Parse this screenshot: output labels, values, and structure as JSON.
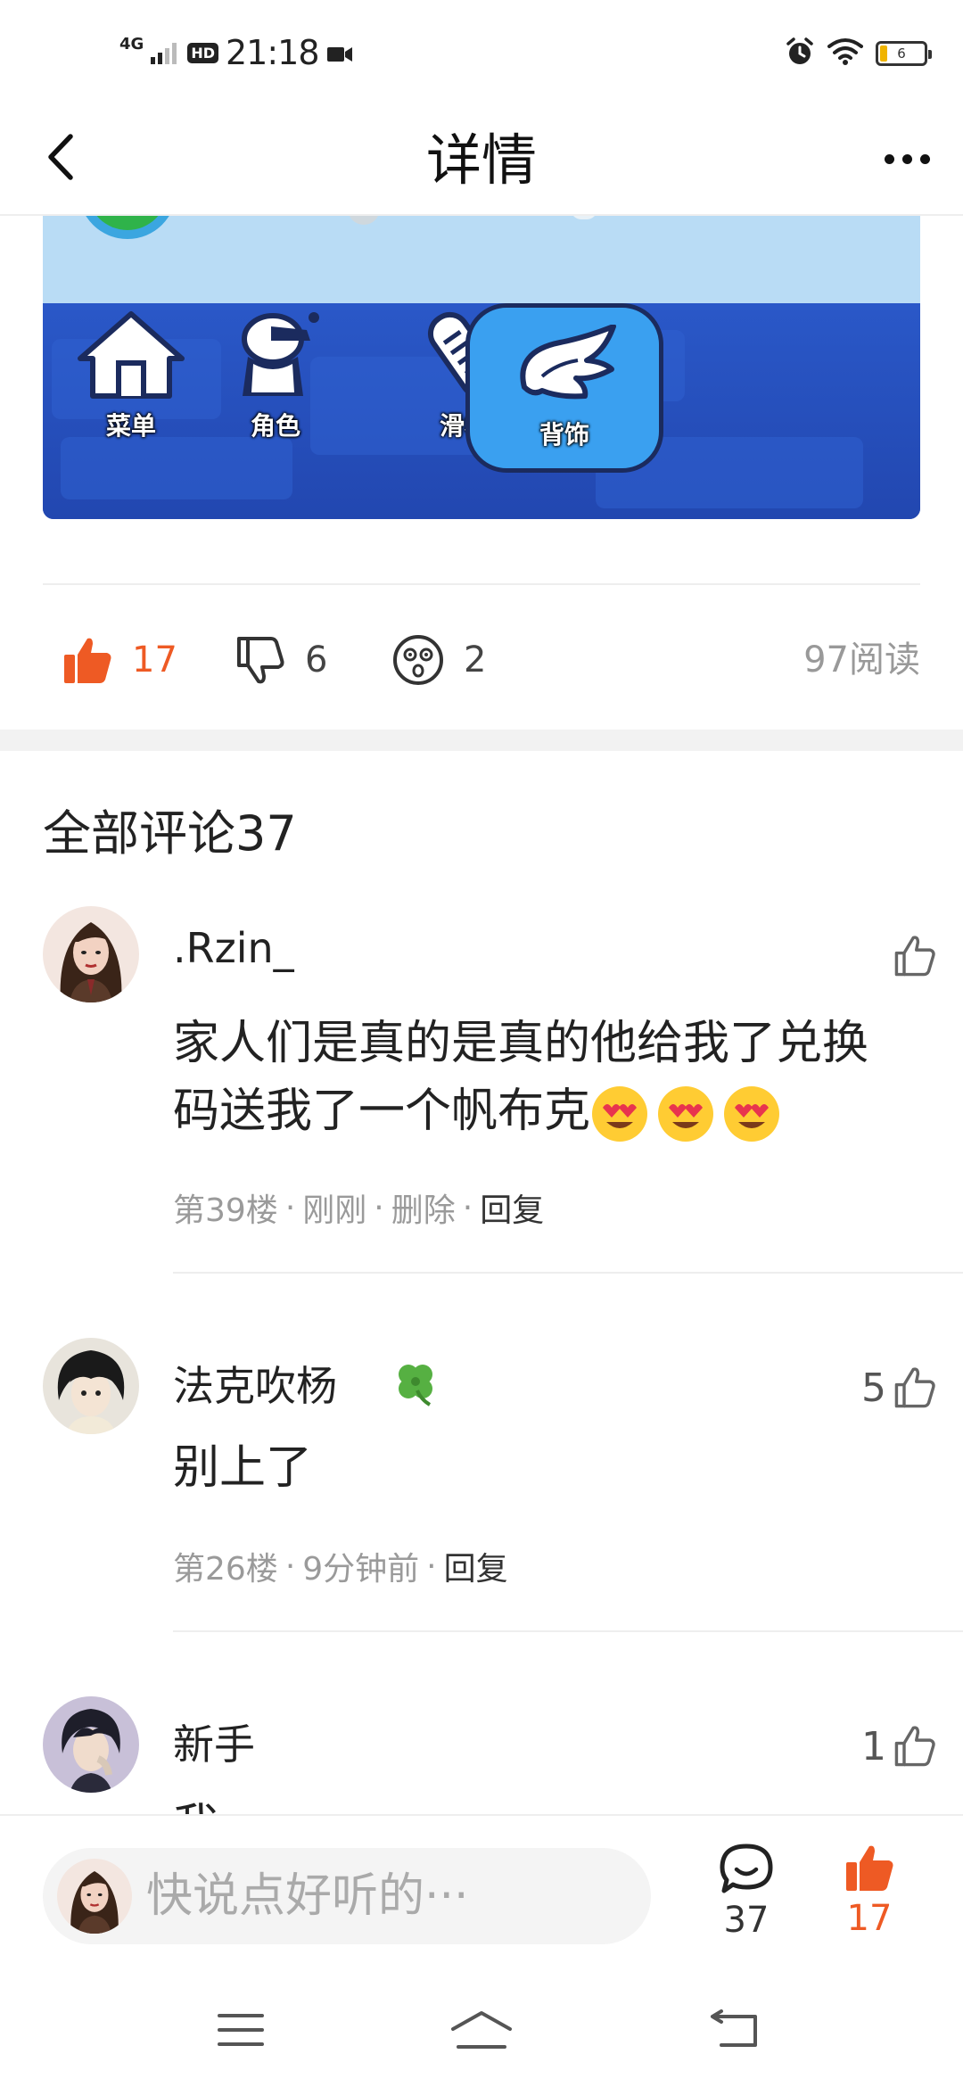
{
  "status_bar": {
    "network": "4G",
    "hd": "HD",
    "time": "21:18",
    "battery": "6"
  },
  "nav": {
    "title": "详情"
  },
  "banner": {
    "items": [
      {
        "label": "菜单",
        "icon": "home-icon"
      },
      {
        "label": "角色",
        "icon": "character-icon"
      },
      {
        "label": "滑板",
        "icon": "skateboard-icon"
      },
      {
        "label": "背饰",
        "icon": "wing-icon",
        "active": true
      }
    ]
  },
  "reactions": {
    "likes": "17",
    "dislikes": "6",
    "wow": "2",
    "reads": "97阅读"
  },
  "comments_header": "全部评论37",
  "comments": [
    {
      "name": ".Rzin_",
      "text": "家人们是真的是真的他给我了兑换码送我了一个帆布克",
      "emoji": "😍😍😍",
      "floor": "第39楼",
      "time": "刚刚",
      "delete": "删除",
      "reply": "回复",
      "likes": ""
    },
    {
      "name": "法克吹杨",
      "badge": "🍀",
      "text": "别上了",
      "floor": "第26楼",
      "time": "9分钟前",
      "reply": "回复",
      "likes": "5"
    },
    {
      "name": "新手",
      "text": "我",
      "likes": "1"
    }
  ],
  "bottom_bar": {
    "placeholder": "快说点好听的···",
    "comment_count": "37",
    "like_count": "17"
  },
  "colors": {
    "accent": "#ee5a24",
    "muted": "#9a9a9a",
    "divider": "#eeeeee"
  }
}
